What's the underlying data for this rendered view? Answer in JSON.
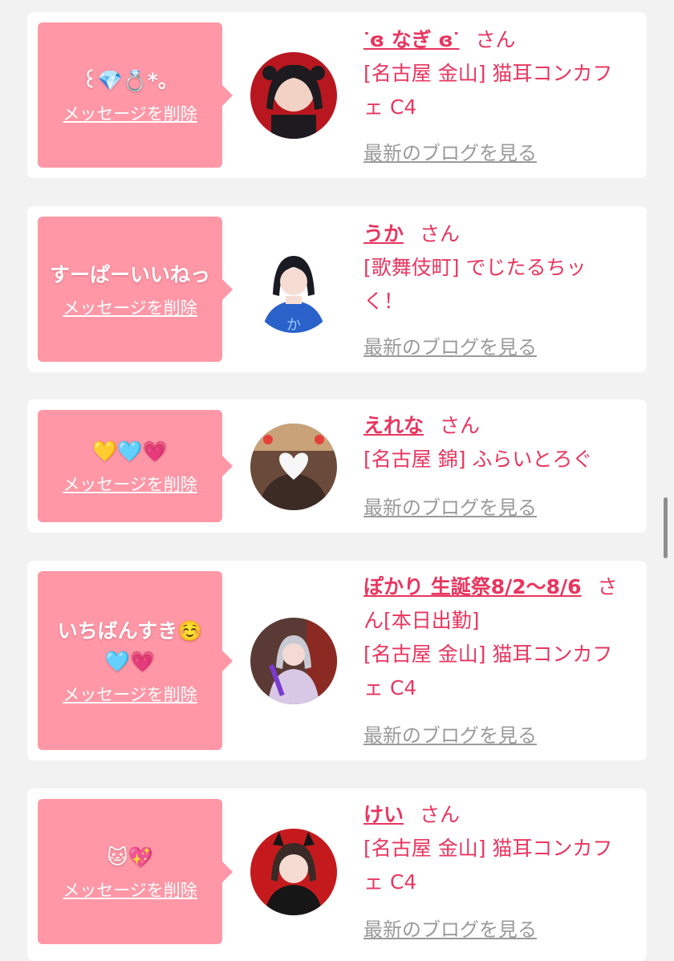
{
  "cards": [
    {
      "message": "꒰💎💍*。",
      "delete_label": "メッセージを削除",
      "name": "ᐝɞ なぎ ɞᐝ",
      "honorific": "さん",
      "shop_lines": [
        "[名古屋 金山] 猫耳コンカフ",
        "ェ C4"
      ],
      "blog_label": "最新のブログを見る"
    },
    {
      "message": "すーぱーいいねっ",
      "delete_label": "メッセージを削除",
      "name": "うか",
      "honorific": "さん",
      "shop_lines": [
        "[歌舞伎町] でじたるちッ",
        "く！"
      ],
      "blog_label": "最新のブログを見る"
    },
    {
      "message": "💛🩵💗",
      "delete_label": "メッセージを削除",
      "name": "えれな",
      "honorific": "さん",
      "shop_lines": [
        "[名古屋 錦] ふらいとろぐ"
      ],
      "blog_label": "最新のブログを見る"
    },
    {
      "message": "いちばんすき☺️",
      "message2": "🩵💗",
      "delete_label": "メッセージを削除",
      "name": "ぽかり 生誕祭8/2〜8/6",
      "honorific": "さ",
      "name_line2": "ん[本日出勤]",
      "shop_lines": [
        "[名古屋 金山] 猫耳コンカフ",
        "ェ C4"
      ],
      "blog_label": "最新のブログを見る"
    },
    {
      "message": "🐱💖",
      "delete_label": "メッセージを削除",
      "name": "けい",
      "honorific": "さん",
      "shop_lines": [
        "[名古屋 金山] 猫耳コンカフ",
        "ェ C4"
      ],
      "blog_label": "最新のブログを見る"
    }
  ],
  "colors": {
    "bubble": "#ff97a6",
    "accent": "#e8365f",
    "muted": "#9a9a9a",
    "background": "#f2f2f2"
  }
}
